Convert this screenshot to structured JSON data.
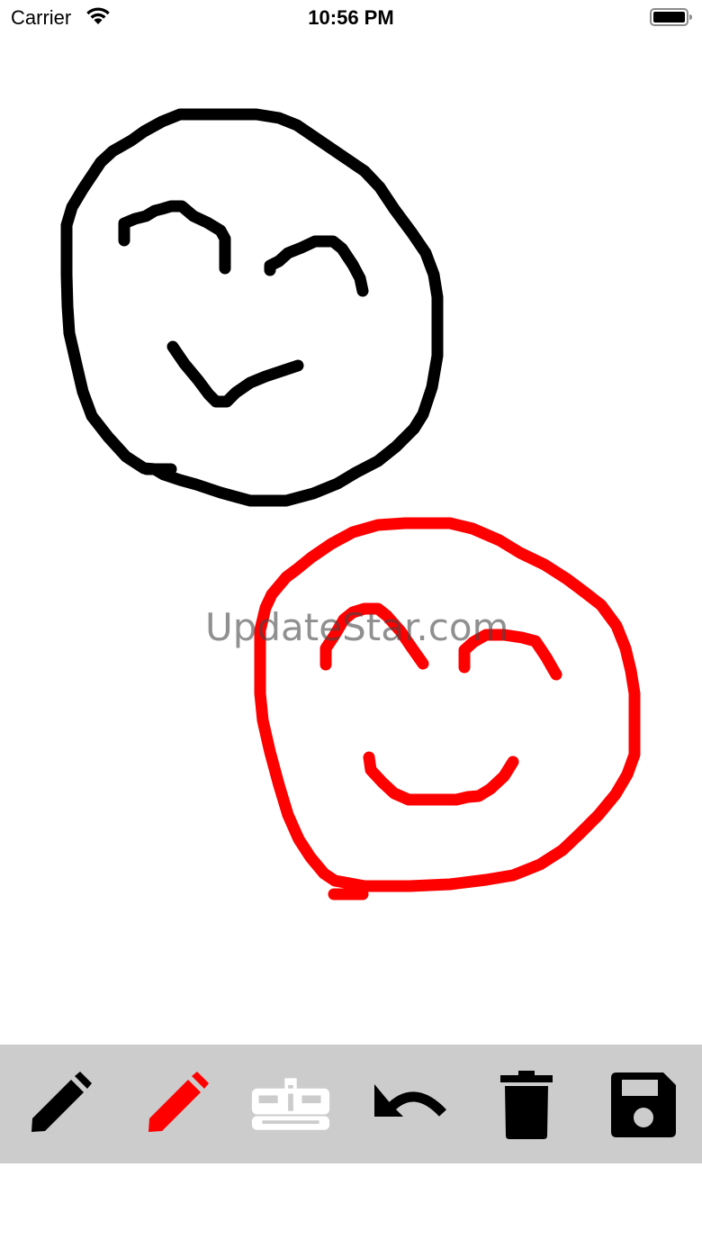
{
  "status_bar": {
    "carrier": "Carrier",
    "time": "10:56 PM",
    "wifi_icon": "wifi-icon",
    "battery_icon": "battery-full-icon"
  },
  "canvas": {
    "strokes": [
      {
        "name": "black-face",
        "color": "#000000"
      },
      {
        "name": "red-face",
        "color": "#ff0000"
      }
    ]
  },
  "watermark": {
    "text": "UpdateStar.com"
  },
  "toolbar": {
    "background": "#cccccc",
    "tools": [
      {
        "name": "black-pencil",
        "icon": "pencil-icon",
        "color": "#000000"
      },
      {
        "name": "red-pencil",
        "icon": "pencil-icon",
        "color": "#ff0000"
      },
      {
        "name": "eraser",
        "icon": "eraser-icon",
        "color": "#ffffff"
      },
      {
        "name": "undo",
        "icon": "undo-icon",
        "color": "#000000"
      },
      {
        "name": "clear",
        "icon": "trash-icon",
        "color": "#000000"
      },
      {
        "name": "save",
        "icon": "floppy-disk-icon",
        "color": "#000000"
      }
    ]
  }
}
